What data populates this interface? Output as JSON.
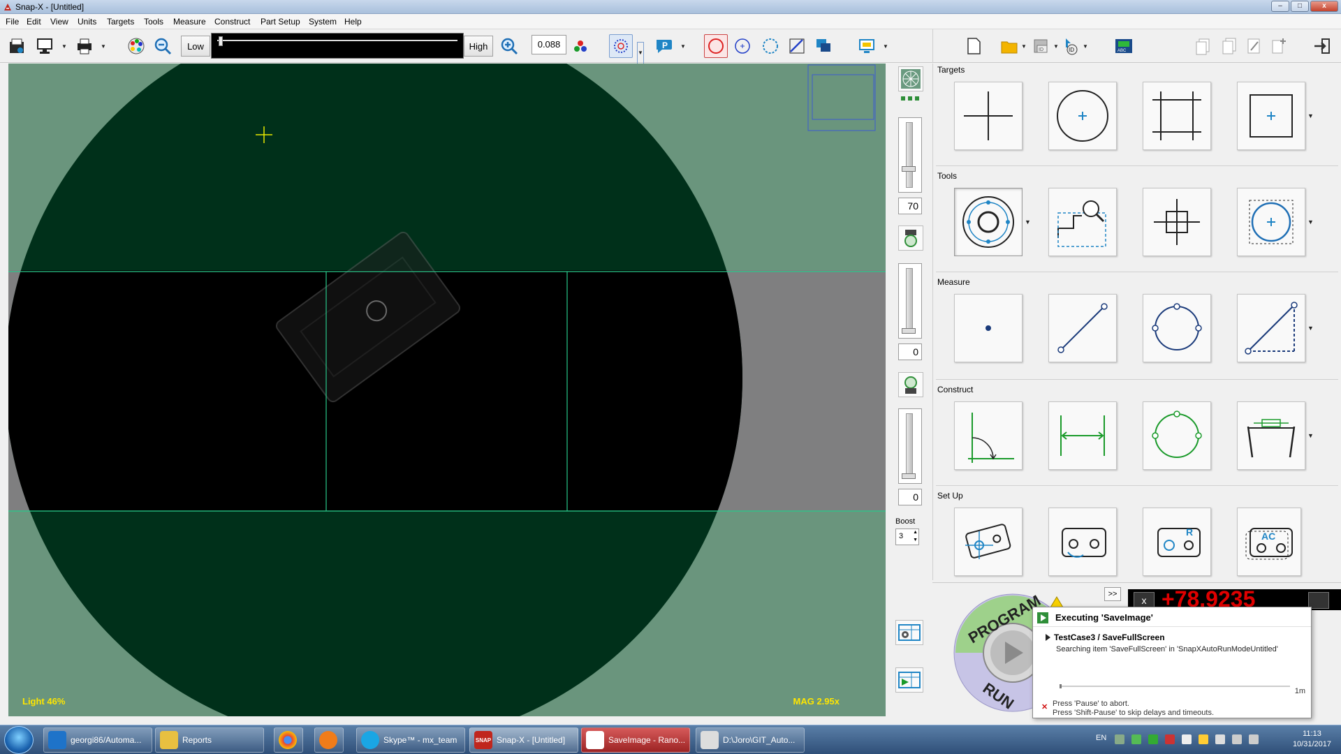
{
  "window": {
    "title": "Snap-X - [Untitled]",
    "minimize": "–",
    "maximize": "□",
    "close": "x"
  },
  "menu": [
    "File",
    "Edit",
    "View",
    "Units",
    "Targets",
    "Tools",
    "Measure",
    "Construct",
    "Part Setup",
    "System",
    "Help"
  ],
  "toolbar": {
    "low_label": "Low",
    "high_label": "High",
    "zoom_value": "0.088"
  },
  "viewport": {
    "light_label": "Light  46%",
    "mag_label": "MAG 2.95x"
  },
  "side_controls": {
    "value_1": "70",
    "value_2": "0",
    "value_3": "0",
    "boost_label": "Boost",
    "boost_value": "3"
  },
  "palette": {
    "sections": [
      "Targets",
      "Tools",
      "Measure",
      "Construct",
      "Set Up"
    ]
  },
  "readout": {
    "value": "+78.9235",
    "expand_button": ">>"
  },
  "program_dial": {
    "program_label": "PROGRAM",
    "run_label": "RUN"
  },
  "notification": {
    "title": "Executing 'SaveImage'",
    "testcase": "TestCase3 / SaveFullScreen",
    "message": "Searching item 'SaveFullScreen' in 'SnapXAutoRunModeUntitled'",
    "progress": 0.01,
    "time": "1m",
    "hint_1": "Press 'Pause' to abort.",
    "hint_2": "Press 'Shift-Pause' to skip delays and timeouts."
  },
  "taskbar": {
    "items": [
      "georgi86/Automa...",
      "Reports",
      "",
      "",
      "Skype™ - mx_team",
      "Snap-X - [Untitled]",
      "SaveImage - Rano...",
      "D:\\Joro\\GIT_Auto..."
    ],
    "app_badge": "SNAP",
    "language": "EN",
    "time": "11:13",
    "date": "10/31/2017"
  },
  "colors": {
    "viewport_bg": "#6a957d",
    "circle": "#00301a",
    "band": "#7f7f80",
    "accent": "#1f85c5",
    "construct": "#1a9a2a"
  }
}
